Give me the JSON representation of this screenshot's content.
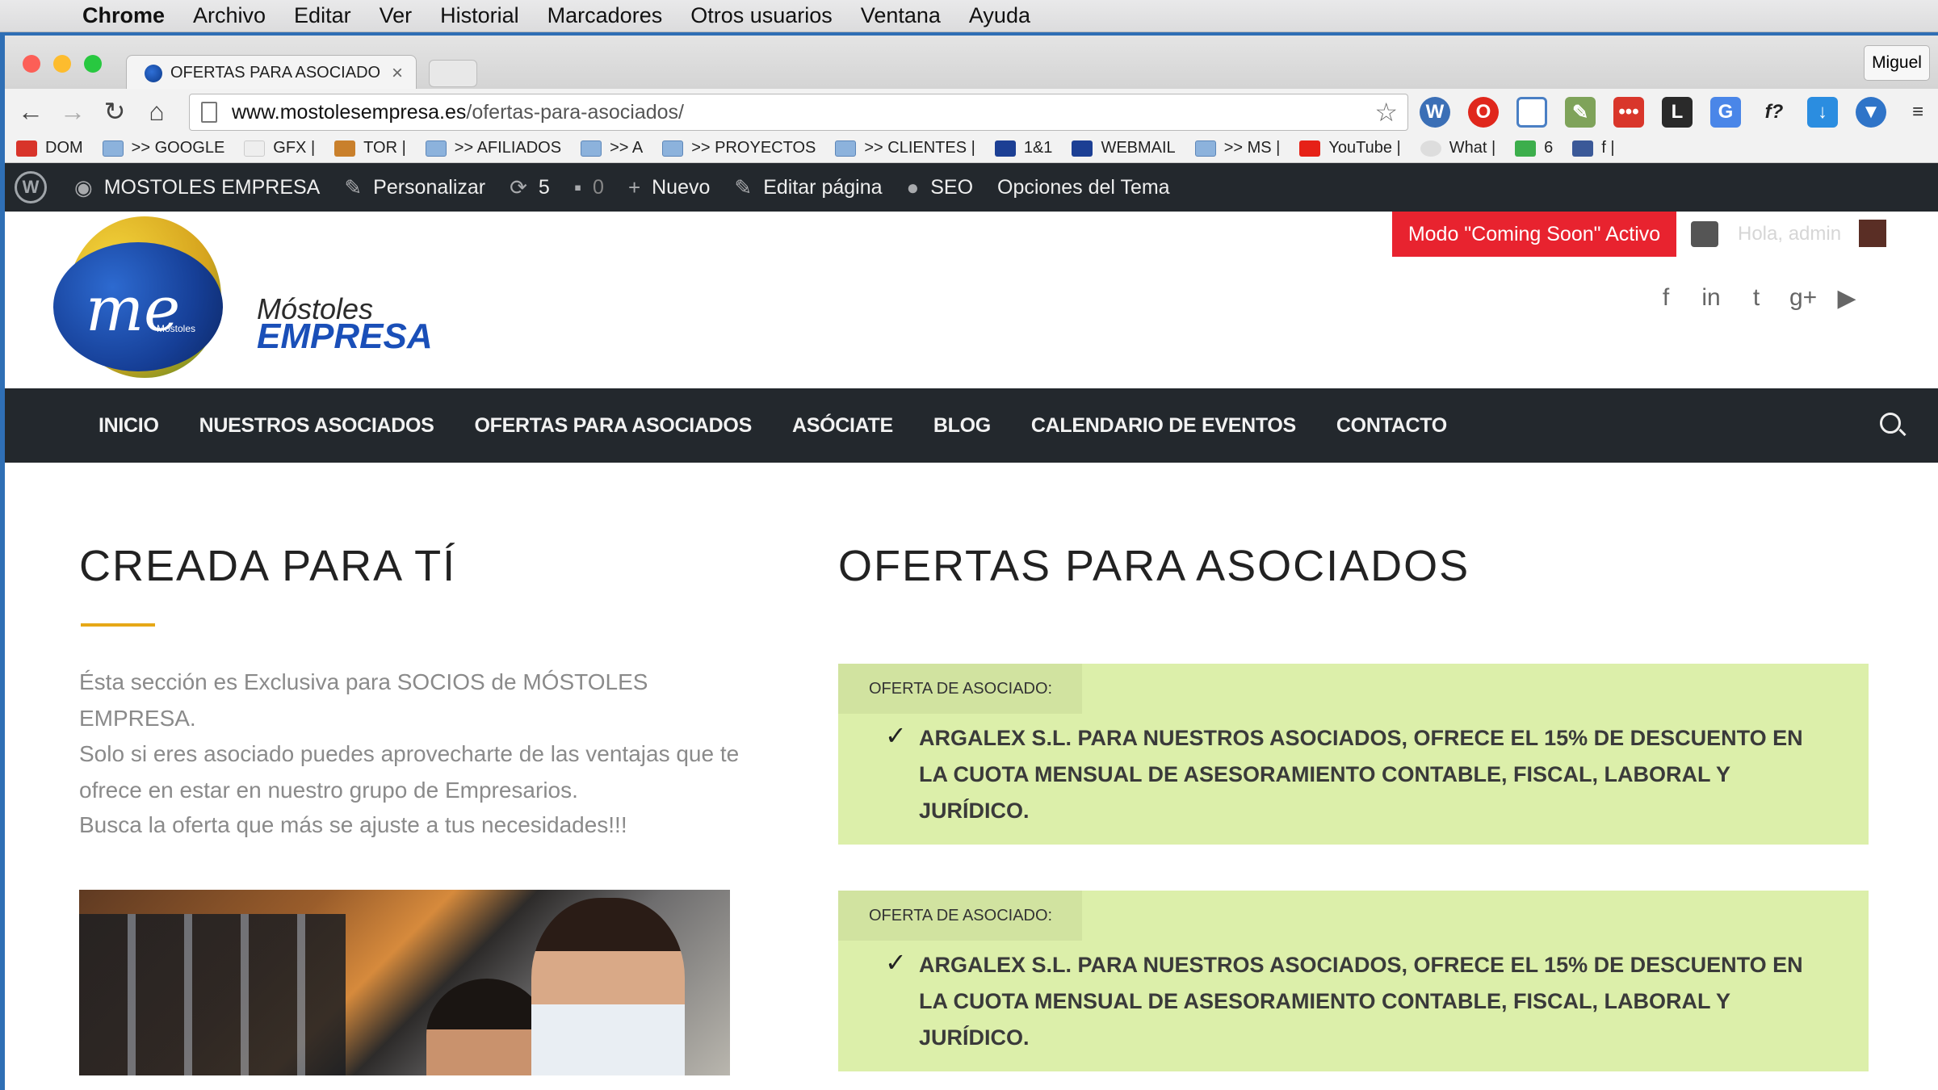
{
  "macmenu": {
    "items": [
      "Chrome",
      "Archivo",
      "Editar",
      "Ver",
      "Historial",
      "Marcadores",
      "Otros usuarios",
      "Ventana",
      "Ayuda"
    ]
  },
  "browser": {
    "tab_title": "OFERTAS PARA ASOCIADO",
    "user": "Miguel",
    "url_host": "www.mostolesempresa.es",
    "url_path": "/ofertas-para-asociados/",
    "bookmarks": [
      "DOM",
      ">> GOOGLE",
      "GFX |",
      "TOR |",
      ">> AFILIADOS",
      ">> A",
      ">> PROYECTOS",
      ">> CLIENTES |",
      "1&1",
      "WEBMAIL",
      ">> MS |",
      "YouTube |",
      "What |",
      "6",
      "f |"
    ]
  },
  "adminbar": {
    "site": "MOSTOLES EMPRESA",
    "customize": "Personalizar",
    "updates": "5",
    "comments": "0",
    "new": "Nuevo",
    "edit": "Editar página",
    "seo": "SEO",
    "theme_options": "Opciones del Tema"
  },
  "header": {
    "logo_me": "me",
    "logo_small": "Móstoles",
    "brand_line1": "Móstoles",
    "brand_line2": "EMPRESA",
    "coming_soon": "Modo \"Coming Soon\" Activo",
    "greeting": "Hola, admin"
  },
  "nav": {
    "items": [
      "INICIO",
      "NUESTROS ASOCIADOS",
      "OFERTAS PARA ASOCIADOS",
      "ASÓCIATE",
      "BLOG",
      "CALENDARIO DE EVENTOS",
      "CONTACTO"
    ]
  },
  "left": {
    "heading": "CREADA PARA TÍ",
    "p1": "Ésta sección es Exclusiva para SOCIOS de MÓSTOLES EMPRESA.",
    "p2": "Solo si eres asociado puedes aprovecharte de las ventajas que te ofrece en estar en nuestro grupo de Empresarios.",
    "p3": "Busca la oferta que más se ajuste a tus necesidades!!!"
  },
  "right": {
    "heading": "OFERTAS PARA ASOCIADOS",
    "offers": [
      {
        "tag": "OFERTA DE ASOCIADO:",
        "text": "ARGALEX S.L. PARA NUESTROS ASOCIADOS, OFRECE EL 15% DE DESCUENTO EN LA CUOTA MENSUAL DE ASESORAMIENTO CONTABLE, FISCAL, LABORAL Y JURÍDICO."
      },
      {
        "tag": "OFERTA DE ASOCIADO:",
        "text": "ARGALEX S.L. PARA NUESTROS ASOCIADOS, OFRECE EL 15% DE DESCUENTO EN LA CUOTA MENSUAL DE ASESORAMIENTO CONTABLE, FISCAL, LABORAL Y JURÍDICO."
      }
    ]
  },
  "colors": {
    "admin_bar": "#23282d",
    "coming_soon": "#e8232f",
    "offer_bg": "#dcefaa",
    "accent_underline": "#e6a817"
  }
}
